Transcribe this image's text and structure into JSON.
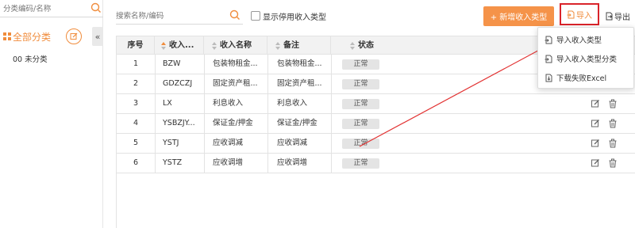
{
  "sidebar": {
    "search_placeholder": "分类编码/名称",
    "title": "全部分类",
    "items": [
      {
        "label": "00 未分类"
      }
    ]
  },
  "toolbar": {
    "search_placeholder": "搜索名称/编码",
    "show_disabled_label": "显示停用收入类型",
    "new_button": "+ 新增收入类型",
    "import_button": "导入",
    "export_button": "导出"
  },
  "import_menu": {
    "items": [
      {
        "label": "导入收入类型"
      },
      {
        "label": "导入收入类型分类"
      },
      {
        "label": "下载失败Excel"
      }
    ]
  },
  "table": {
    "headers": {
      "index": "序号",
      "code": "收入...",
      "name": "收入名称",
      "remark": "备注",
      "status": "状态"
    },
    "rows": [
      {
        "index": "1",
        "code": "BZW",
        "name": "包装物租金...",
        "remark": "包装物租金...",
        "status": "正常"
      },
      {
        "index": "2",
        "code": "GDZCZJ",
        "name": "固定资产租...",
        "remark": "固定资产租...",
        "status": "正常"
      },
      {
        "index": "3",
        "code": "LX",
        "name": "利息收入",
        "remark": "利息收入",
        "status": "正常"
      },
      {
        "index": "4",
        "code": "YSBZJY...",
        "name": "保证金/押金",
        "remark": "保证金/押金",
        "status": "正常"
      },
      {
        "index": "5",
        "code": "YSTJ",
        "name": "应收调减",
        "remark": "应收调减",
        "status": "正常"
      },
      {
        "index": "6",
        "code": "YSTZ",
        "name": "应收调增",
        "remark": "应收调增",
        "status": "正常"
      }
    ]
  },
  "colors": {
    "accent": "#f59349",
    "highlight": "#d9232a",
    "header_bg": "#f2f2f2"
  }
}
